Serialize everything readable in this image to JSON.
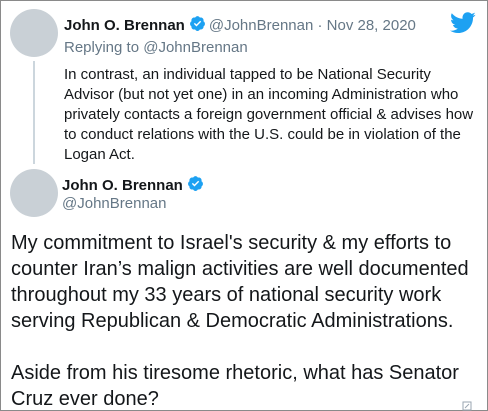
{
  "parent_tweet": {
    "name": "John O. Brennan",
    "handle": "@JohnBrennan",
    "separator": "·",
    "date": "Nov 28, 2020",
    "replying_to_label": "Replying to",
    "replying_to_handle": "@JohnBrennan",
    "text": "In contrast, an individual tapped to be National Security Advisor (but not yet one) in an incoming Administration who privately contacts a foreign government official & advises how to conduct relations with the U.S. could be in violation of the Logan Act."
  },
  "main_tweet": {
    "name": "John O. Brennan",
    "handle": "@JohnBrennan",
    "paragraph_1": "My commitment to Israel's security & my efforts to counter Iran’s malign activities are well documented throughout my 33 years of national security work serving Republican & Democratic Administrations.",
    "paragraph_2": "Aside from his tiresome rhetoric, what has Senator Cruz ever done?"
  },
  "colors": {
    "twitter_blue": "#1da1f2",
    "muted_text": "#657786",
    "avatar_placeholder": "#c9d0d6"
  },
  "icons": {
    "brand": "twitter-bird-icon",
    "verified": "verified-badge-icon"
  }
}
